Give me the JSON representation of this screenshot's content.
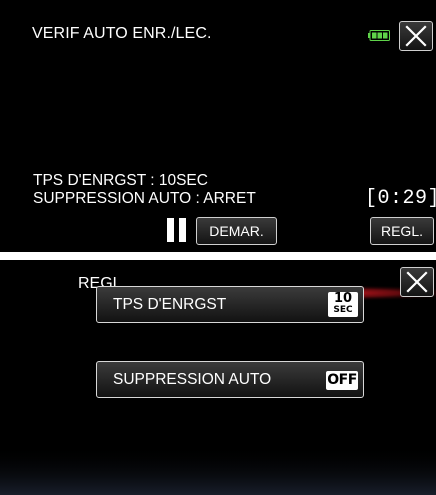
{
  "screen1": {
    "title": "VERIF AUTO ENR./LEC.",
    "info_line1": "TPS D'ENRGST : 10SEC",
    "info_line2": "SUPPRESSION AUTO : ARRET",
    "timer": "[0:29]",
    "start_button": "DEMAR.",
    "settings_button": "REGL.",
    "battery_color": "#5fd34a"
  },
  "screen2": {
    "title": "REGL.",
    "accent_color": "#c0141c",
    "menu": [
      {
        "label": "TPS D'ENRGST",
        "value_num": "10",
        "value_unit": "SEC"
      },
      {
        "label": "SUPPRESSION AUTO",
        "value": "OFF"
      }
    ]
  },
  "icons": [
    "battery-icon",
    "close-icon",
    "pause-icon"
  ]
}
